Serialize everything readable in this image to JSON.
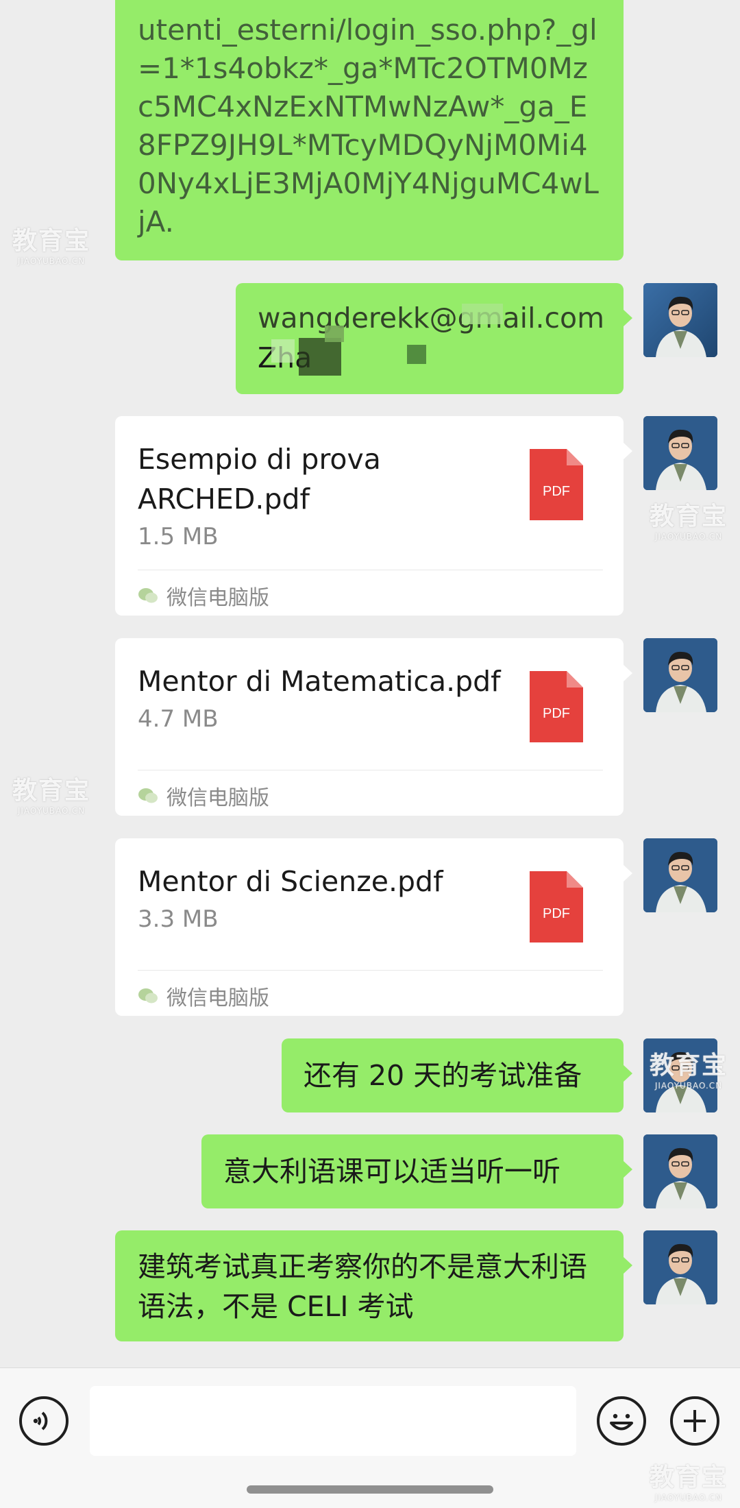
{
  "messages": {
    "link_message": {
      "text": "utenti_esterni/login_sso.php?_gl=1*1s4obkz*_ga*MTc2OTM0Mzc5MC4xNzExNTMwNzAw*_ga_E8FPZ9JH9L*MTcyMDQyNjM0Mi40Ny4xLjE3MjA0MjY4NjguMC4wLjA."
    },
    "email_message": {
      "line1": "wangderekk@gmail.com",
      "line2": "Zha"
    },
    "files": [
      {
        "name": "Esempio di prova ARCHED.pdf",
        "size": "1.5 MB",
        "icon_label": "PDF",
        "source": "微信电脑版"
      },
      {
        "name": "Mentor di Matematica.pdf",
        "size": "4.7 MB",
        "icon_label": "PDF",
        "source": "微信电脑版"
      },
      {
        "name": "Mentor di Scienze.pdf",
        "size": "3.3 MB",
        "icon_label": "PDF",
        "source": "微信电脑版"
      }
    ],
    "text_messages": [
      {
        "text": "还有 20 天的考试准备"
      },
      {
        "text": "意大利语课可以适当听一听"
      },
      {
        "text": "建筑考试真正考察你的不是意大利语语法，不是 CELI 考试"
      }
    ]
  },
  "watermark": {
    "main": "教育宝",
    "sub": "JIAOYUBAO.CN"
  },
  "input_bar": {
    "voice_icon": "voice-icon",
    "emoji_icon": "emoji-icon",
    "plus_icon": "plus-icon",
    "input_value": ""
  },
  "colors": {
    "sent_bubble": "#95ec69",
    "file_bubble": "#ffffff",
    "background": "#ededed",
    "pdf_red": "#e5413d"
  }
}
